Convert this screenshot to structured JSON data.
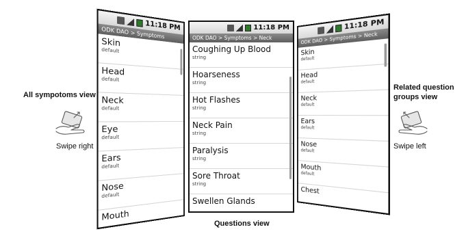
{
  "captions": {
    "all_symptoms": "All sympotoms view",
    "swipe_right": "Swipe right",
    "related": "Related question groups view",
    "swipe_left": "Swipe left",
    "questions": "Questions view"
  },
  "icons": {
    "hand_left": "swipe-right-hand-icon",
    "hand_right": "swipe-left-hand-icon"
  },
  "phones": {
    "left": {
      "time": "11:18 PM",
      "title": "ODK DAO > Symptoms",
      "items": [
        {
          "name": "Skin",
          "type": "default"
        },
        {
          "name": "Head",
          "type": "default"
        },
        {
          "name": "Neck",
          "type": "default"
        },
        {
          "name": "Eye",
          "type": "default"
        },
        {
          "name": "Ears",
          "type": "default"
        },
        {
          "name": "Nose",
          "type": "default"
        },
        {
          "name": "Mouth",
          "type": ""
        }
      ]
    },
    "center": {
      "time": "11:18 PM",
      "title": "ODK DAO > Symptoms > Neck",
      "items": [
        {
          "name": "Coughing Up Blood",
          "type": "string"
        },
        {
          "name": "Hoarseness",
          "type": "string"
        },
        {
          "name": "Hot Flashes",
          "type": "string"
        },
        {
          "name": "Neck Pain",
          "type": "string"
        },
        {
          "name": "Paralysis",
          "type": "string"
        },
        {
          "name": "Sore Throat",
          "type": "string"
        },
        {
          "name": "Swellen Glands",
          "type": ""
        }
      ]
    },
    "right": {
      "time": "11:18 PM",
      "title": "ODK DAO > Symptoms > Neck",
      "items": [
        {
          "name": "Skin",
          "type": "default"
        },
        {
          "name": "Head",
          "type": "default"
        },
        {
          "name": "Neck",
          "type": "default"
        },
        {
          "name": "Ears",
          "type": "default"
        },
        {
          "name": "Nose",
          "type": "default"
        },
        {
          "name": "Mouth",
          "type": "default"
        },
        {
          "name": "Chest",
          "type": ""
        }
      ]
    }
  }
}
